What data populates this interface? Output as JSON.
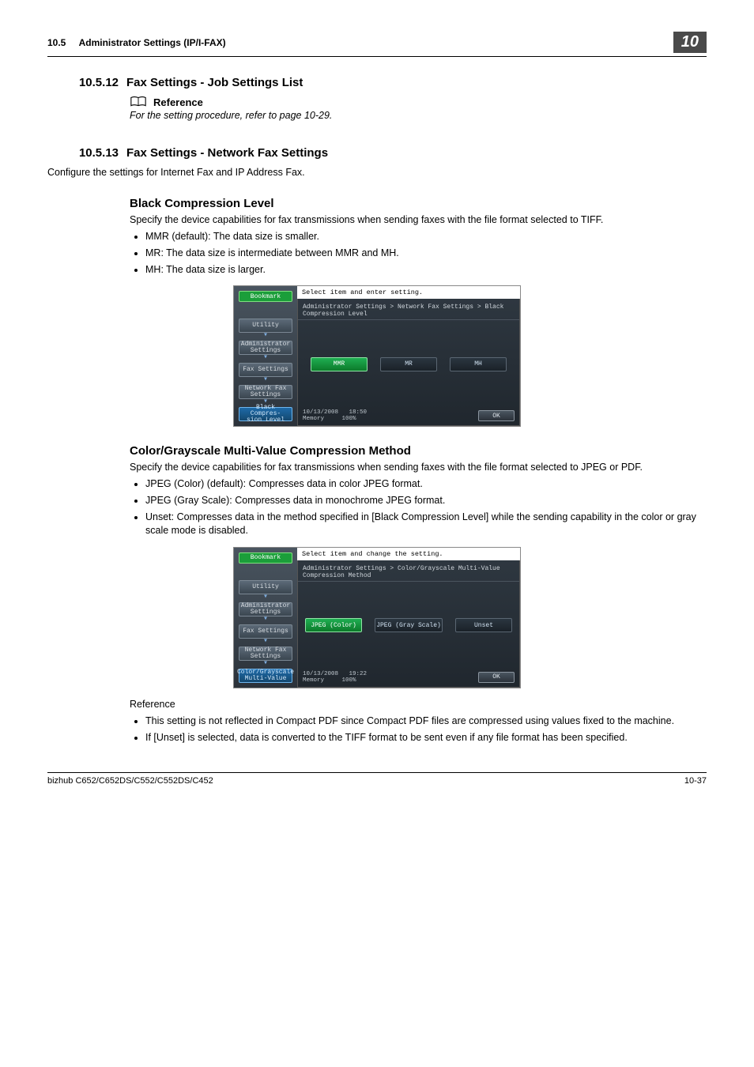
{
  "header": {
    "section_number": "10.5",
    "section_title": "Administrator Settings (IP/I-FAX)",
    "chapter_badge": "10"
  },
  "sec1": {
    "num": "10.5.12",
    "title": "Fax Settings - Job Settings List",
    "reference_label": "Reference",
    "reference_text": "For the setting procedure, refer to page 10-29."
  },
  "sec2": {
    "num": "10.5.13",
    "title": "Fax Settings - Network Fax Settings",
    "intro": "Configure the settings for Internet Fax and IP Address Fax."
  },
  "black": {
    "heading": "Black Compression Level",
    "intro": "Specify the device capabilities for fax transmissions when sending faxes with the file format selected to TIFF.",
    "items": [
      "MMR (default): The data size is smaller.",
      "MR: The data size is intermediate between MMR and MH.",
      "MH: The data size is larger."
    ]
  },
  "color": {
    "heading": "Color/Grayscale Multi-Value Compression Method",
    "intro": "Specify the device capabilities for fax transmissions when sending faxes with the file format selected to JPEG or PDF.",
    "items": [
      "JPEG (Color) (default): Compresses data in color JPEG format.",
      "JPEG (Gray Scale): Compresses data in monochrome JPEG format.",
      "Unset: Compresses data in the method specified in [Black Compression Level] while the sending capability in the color or gray scale mode is disabled."
    ],
    "ref_label": "Reference",
    "ref_items": [
      "This setting is not reflected in Compact PDF since Compact PDF files are compressed using values fixed to the machine.",
      "If [Unset] is selected, data is converted to the TIFF format to be sent even if any file format has been specified."
    ]
  },
  "ss1": {
    "instruct": "Select item and enter setting.",
    "crumb": "Administrator Settings > Network Fax Settings > Black Compression Level",
    "bookmark": "Bookmark",
    "nav": [
      "Utility",
      "Administrator Settings",
      "Fax Settings",
      "Network Fax Settings"
    ],
    "current": "Black Compres-\nsion Level",
    "options": [
      "MMR",
      "MR",
      "MH"
    ],
    "date": "10/13/2008",
    "time": "18:50",
    "mem_label": "Memory",
    "mem_val": "100%",
    "ok": "OK"
  },
  "ss2": {
    "instruct": "Select item and change the setting.",
    "crumb": "Administrator Settings > Color/Grayscale Multi-Value Compression Method",
    "bookmark": "Bookmark",
    "nav": [
      "Utility",
      "Administrator Settings",
      "Fax Settings",
      "Network Fax Settings"
    ],
    "current": "Color/Grayscale\nMulti-Value",
    "options": [
      "JPEG (Color)",
      "JPEG (Gray Scale)",
      "Unset"
    ],
    "date": "10/13/2008",
    "time": "19:22",
    "mem_label": "Memory",
    "mem_val": "100%",
    "ok": "OK"
  },
  "footer": {
    "left": "bizhub C652/C652DS/C552/C552DS/C452",
    "right": "10-37"
  }
}
